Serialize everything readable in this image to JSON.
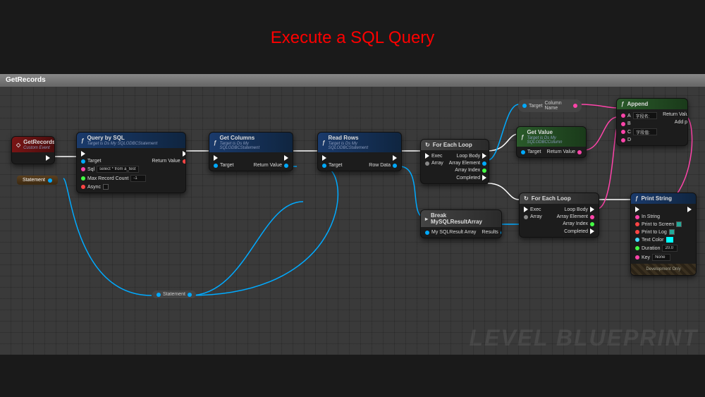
{
  "title": "Execute a SQL Query",
  "tab": "GetRecords",
  "watermark": "LEVEL BLUEPRINT",
  "event": {
    "name": "GetRecords",
    "sub": "Custom Event"
  },
  "variable": {
    "name": "Statement"
  },
  "reroute": {
    "label": "Statement"
  },
  "queryBySQL": {
    "title": "Query by SQL",
    "sub": "Target is Ds My SQLODBCStatement",
    "target": "Target",
    "sql_label": "Sql",
    "sql_value": "select * from a_test",
    "max_label": "Max Record Count",
    "max_value": "-1",
    "async_label": "Async",
    "return": "Return Value"
  },
  "getColumns": {
    "title": "Get Columns",
    "sub": "Target is Ds My SQLODBCStatement",
    "target": "Target",
    "return": "Return Value"
  },
  "readRows": {
    "title": "Read Rows",
    "sub": "Target is Ds My SQLODBCStatement",
    "target": "Target",
    "return": "Row Data"
  },
  "forEach1": {
    "title": "For Each Loop",
    "exec": "Exec",
    "array": "Array",
    "loopBody": "Loop Body",
    "arrayElement": "Array Element",
    "arrayIndex": "Array Index",
    "completed": "Completed"
  },
  "forEach2": {
    "title": "For Each Loop",
    "exec": "Exec",
    "array": "Array",
    "loopBody": "Loop Body",
    "arrayElement": "Array Element",
    "arrayIndex": "Array Index",
    "completed": "Completed"
  },
  "targetColumn": {
    "target": "Target",
    "colName": "Column Name"
  },
  "getValue": {
    "title": "Get Value",
    "sub": "Target is Ds My SQLODBCColumn",
    "target": "Target",
    "return": "Return Value"
  },
  "breakResult": {
    "title": "Break MySQLResultArray",
    "input": "My SQLResult Array",
    "output": "Results"
  },
  "append": {
    "title": "Append",
    "a": "A",
    "a_val": "字段名:",
    "b": "B",
    "c": "C",
    "c_val": "字段值:",
    "d": "D",
    "return": "Return Value",
    "addpin": "Add pin"
  },
  "printString": {
    "title": "Print String",
    "inString": "In String",
    "p2s": "Print to Screen",
    "p2l": "Print to Log",
    "textColor": "Text Color",
    "duration": "Duration",
    "dur_val": "20.0",
    "key": "Key",
    "key_val": "None",
    "dev": "Development Only"
  }
}
